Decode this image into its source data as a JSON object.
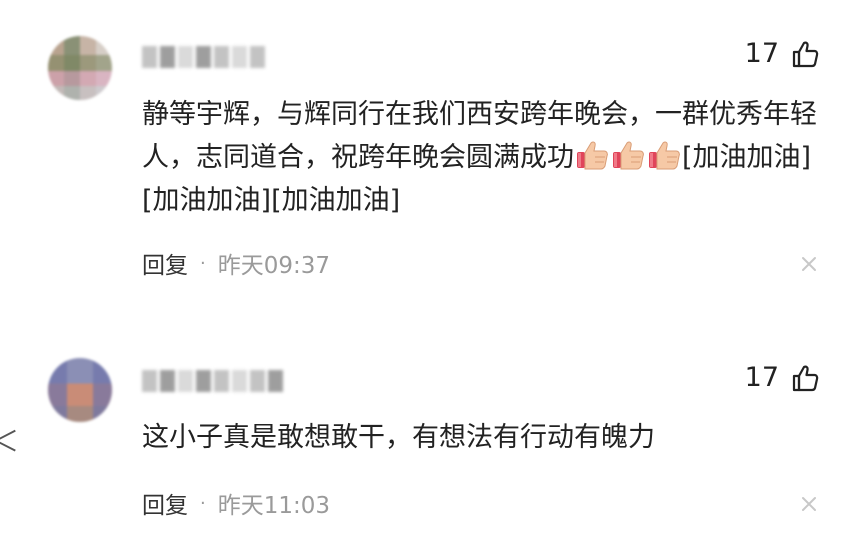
{
  "comments": [
    {
      "text_before": "静等宇辉，与辉同行在我们西安跨年晚会，一群优秀年轻人，志同道合，祝跨年晚会圆满成功",
      "emoji": [
        "thumbs-up",
        "thumbs-up",
        "thumbs-up"
      ],
      "text_after": "[加油加油][加油加油][加油加油]",
      "likes": "17",
      "reply_label": "回复",
      "separator": "·",
      "time": "昨天09:37"
    },
    {
      "text_before": "这小子真是敢想敢干，有想法有行动有魄力",
      "emoji": [],
      "text_after": "",
      "likes": "17",
      "reply_label": "回复",
      "separator": "·",
      "time": "昨天11:03"
    }
  ],
  "icons": {
    "like": "thumbs-up-outline-icon",
    "dismiss": "close-icon",
    "emoji": "thumbs-up-emoji"
  },
  "colors": {
    "text": "#222222",
    "meta": "#9a9a9a",
    "close": "#c8c8c8"
  }
}
